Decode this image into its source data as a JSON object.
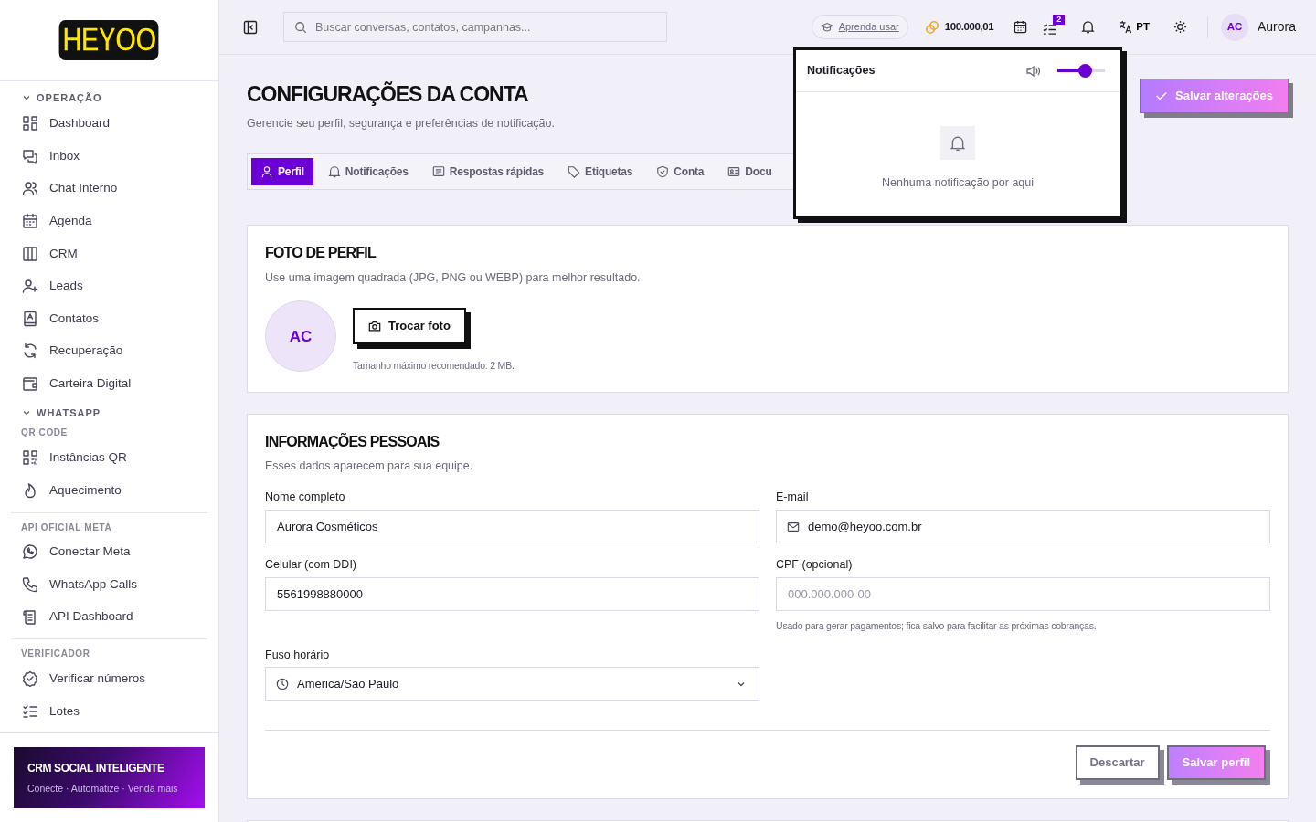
{
  "brand": {
    "logo": "HEYOO"
  },
  "sidebar": {
    "sections": [
      {
        "title": "OPERAÇÃO",
        "expanded": true,
        "groups": [
          {
            "items": [
              {
                "label": "Dashboard"
              },
              {
                "label": "Inbox"
              },
              {
                "label": "Chat Interno"
              },
              {
                "label": "Agenda"
              },
              {
                "label": "CRM"
              },
              {
                "label": "Leads"
              },
              {
                "label": "Contatos"
              },
              {
                "label": "Recuperação"
              },
              {
                "label": "Carteira Digital"
              }
            ]
          }
        ]
      },
      {
        "title": "WHATSAPP",
        "expanded": true,
        "groups": [
          {
            "label": "QR CODE",
            "items": [
              {
                "label": "Instâncias QR"
              },
              {
                "label": "Aquecimento"
              }
            ]
          },
          {
            "label": "API OFICIAL META",
            "items": [
              {
                "label": "Conectar Meta"
              },
              {
                "label": "WhatsApp Calls"
              },
              {
                "label": "API Dashboard"
              }
            ]
          },
          {
            "label": "VERIFICADOR",
            "items": [
              {
                "label": "Verificar números"
              },
              {
                "label": "Lotes"
              }
            ]
          }
        ]
      }
    ],
    "promo": {
      "title": "CRM SOCIAL INTELIGENTE",
      "subtitle": "Conecte · Automatize · Venda mais"
    }
  },
  "topbar": {
    "search": {
      "placeholder": "Buscar conversas, contatos, campanhas..."
    },
    "learn": "Aprenda usar",
    "credits": "100.000,01",
    "tasks_badge": "2",
    "language": "PT",
    "user": {
      "initials": "AC",
      "name": "Aurora"
    }
  },
  "notifications": {
    "title": "Notificações",
    "volume": {
      "level": 0.58
    },
    "empty": "Nenhuma notificação por aqui"
  },
  "page": {
    "title": "CONFIGURAÇÕES DA CONTA",
    "subtitle": "Gerencie seu perfil, segurança e preferências de notificação.",
    "save_button": "Salvar alterações",
    "tabs": [
      {
        "label": "Perfil",
        "selected": true
      },
      {
        "label": "Notificações",
        "selected": false
      },
      {
        "label": "Respostas rápidas",
        "selected": false
      },
      {
        "label": "Etiquetas",
        "selected": false
      },
      {
        "label": "Conta",
        "selected": false
      },
      {
        "label": "Docu",
        "selected": false
      }
    ]
  },
  "photo_card": {
    "title": "FOTO DE PERFIL",
    "subtitle": "Use uma imagem quadrada (JPG, PNG ou WEBP) para melhor resultado.",
    "avatar": "AC",
    "button": "Trocar foto",
    "hint": "Tamanho máximo recomendado: 2 MB."
  },
  "personal_card": {
    "title": "INFORMAÇÕES PESSOAIS",
    "subtitle": "Esses dados aparecem para sua equipe.",
    "fields": [
      {
        "label": "Nome completo",
        "value": "Aurora Cosméticos",
        "kind": "text"
      },
      {
        "label": "E-mail",
        "value": "demo@heyoo.com.br",
        "kind": "email"
      },
      {
        "label": "Celular (com DDI)",
        "value": "5561998880000",
        "kind": "text"
      },
      {
        "label": "CPF (opcional)",
        "placeholder": "000.000.000-00",
        "hint": "Usado para gerar pagamentos; fica salvo para facilitar as próximas cobranças.",
        "kind": "text"
      },
      {
        "label": "Fuso horário",
        "value": "America/Sao Paulo",
        "kind": "select"
      }
    ],
    "buttons": {
      "discard": "Descartar",
      "save": "Salvar perfil"
    }
  }
}
